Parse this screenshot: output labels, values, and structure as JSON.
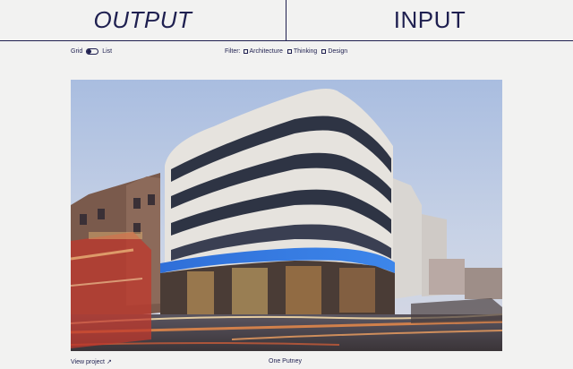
{
  "header": {
    "output_label": "OUTPUT",
    "input_label": "INPUT"
  },
  "controls": {
    "grid_label": "Grid",
    "list_label": "List",
    "filter_label": "Filter:",
    "filters": [
      "Architecture",
      "Thinking",
      "Design"
    ]
  },
  "project": {
    "view_link": "View project ↗",
    "name": "One Putney"
  },
  "colors": {
    "ink": "#1f2050",
    "background": "#f2f2f1"
  }
}
